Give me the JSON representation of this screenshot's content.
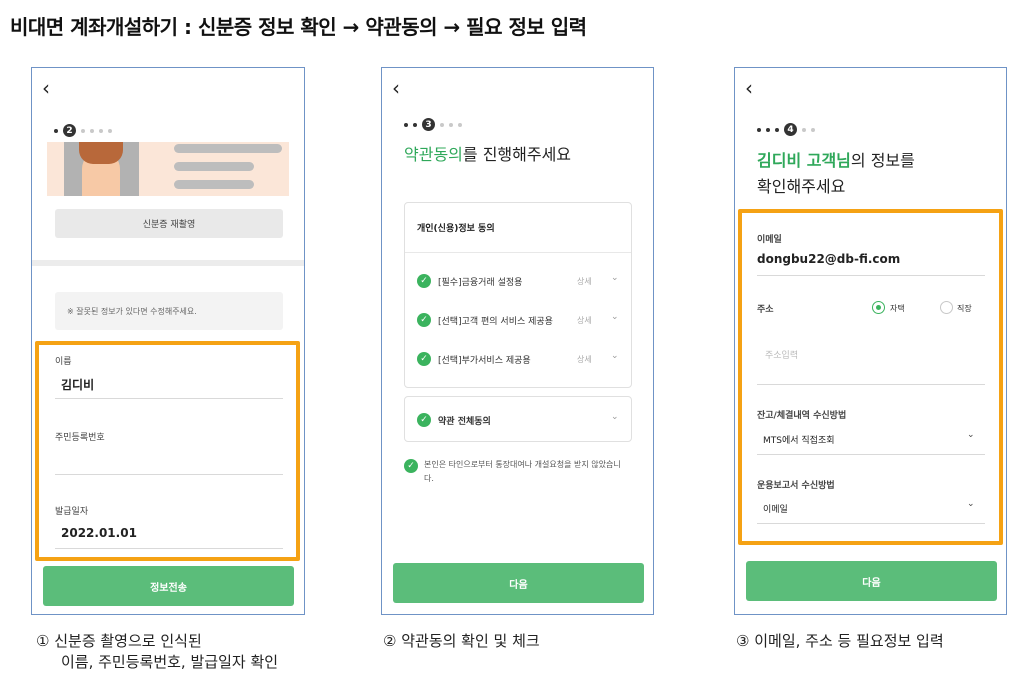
{
  "title": "비대면 계좌개설하기 : 신분증 정보 확인 → 약관동의 → 필요 정보 입력",
  "icons": {
    "back": "chevron-left-icon",
    "check": "check-circle-icon",
    "chevron": "chevron-down-icon"
  },
  "colors": {
    "accent_green": "#2fa85a",
    "button_green": "#5bbd7a",
    "highlight_orange": "#f5a214"
  },
  "back_glyph": "‹",
  "screen1": {
    "step_current": "2",
    "retake_label": "신분증 재촬영",
    "notice": "※ 잘못된 정보가 있다면 수정해주세요.",
    "fields": [
      {
        "label": "이름",
        "value": "김디비"
      },
      {
        "label": "주민등록번호",
        "value": ""
      },
      {
        "label": "발급일자",
        "value": "2022.01.01"
      }
    ],
    "submit_label": "정보전송"
  },
  "screen2": {
    "step_current": "3",
    "headline_accent": "약관동의",
    "headline_rest": "를 진행해주세요",
    "consent_header": "개인(신용)정보 동의",
    "items": [
      {
        "label": "[필수]금융거래 설정용",
        "detail": "상세"
      },
      {
        "label": "[선택]고객 편의 서비스 제공용",
        "detail": "상세"
      },
      {
        "label": "[선택]부가서비스 제공용",
        "detail": "상세"
      }
    ],
    "all_agree": "약관 전체동의",
    "self_notice": "본인은 타인으로부터 통장대여나 개설요청을 받지 않았습니다.",
    "next_label": "다음"
  },
  "screen3": {
    "step_current": "4",
    "headline_accent": "김디비 고객님",
    "headline_rest": "의 정보를",
    "headline_line2": "확인해주세요",
    "email_label": "이메일",
    "email_value": "dongbu22@db-fi.com",
    "address_label": "주소",
    "address_options": [
      "자택",
      "직장"
    ],
    "address_selected": "자택",
    "address_placeholder": "주소입력",
    "balance_label": "잔고/체결내역 수신방법",
    "balance_value": "MTS에서 직접조회",
    "report_label": "운용보고서 수신방법",
    "report_value": "이메일",
    "next_label": "다음"
  },
  "captions": [
    {
      "line1": "① 신분증 촬영으로 인식된",
      "line2": "이름, 주민등록번호, 발급일자 확인"
    },
    {
      "line1": "② 약관동의 확인 및 체크"
    },
    {
      "line1": "③ 이메일, 주소 등 필요정보 입력"
    }
  ]
}
